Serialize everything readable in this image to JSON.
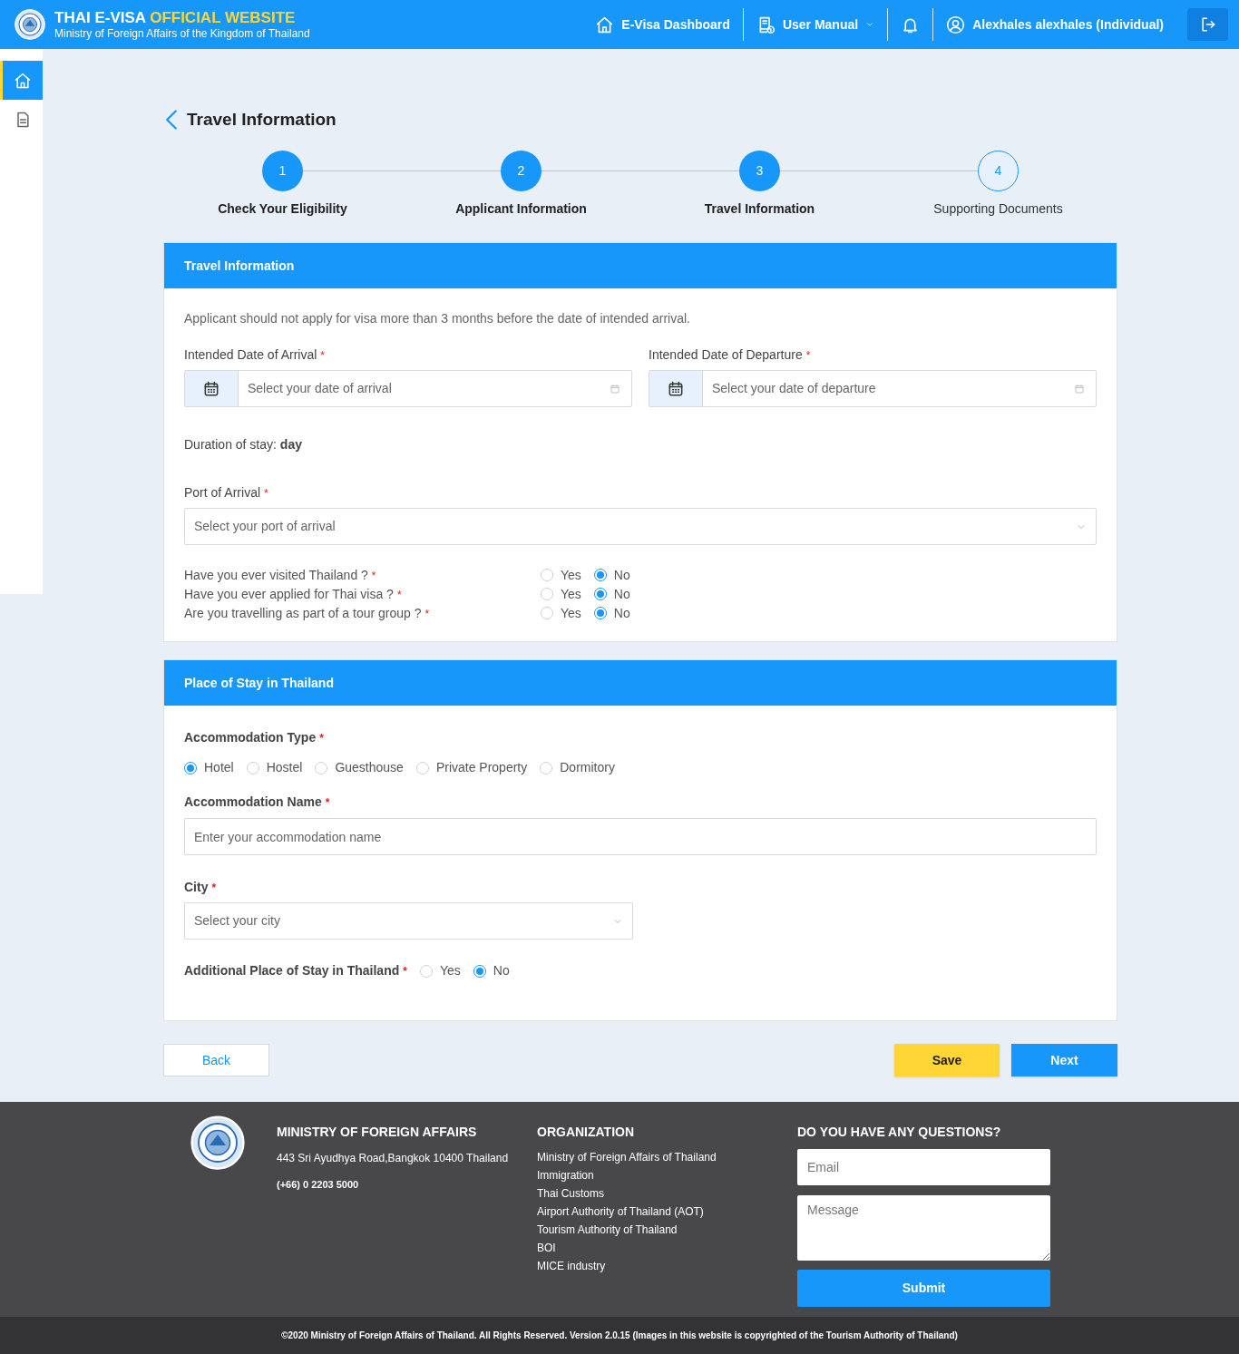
{
  "header": {
    "title": "THAI E-VISA",
    "title_highlight": "OFFICIAL WEBSITE",
    "subtitle": "Ministry of Foreign Affairs of the Kingdom of Thailand",
    "nav": [
      {
        "kind": "home",
        "label": "E-Visa Dashboard"
      },
      {
        "kind": "manual",
        "label": "User Manual"
      },
      {
        "kind": "bell"
      },
      {
        "kind": "user",
        "label": "Alexhales alexhales (Individual)"
      }
    ]
  },
  "sidebar": {
    "items": [
      {
        "kind": "home",
        "selected": true
      },
      {
        "kind": "document",
        "selected": false
      }
    ]
  },
  "page_title": "Travel Information",
  "steps": [
    {
      "number": "1",
      "label": "Check Your Eligibility",
      "completed": true
    },
    {
      "number": "2",
      "label": "Applicant Information",
      "completed": true
    },
    {
      "number": "3",
      "label": "Travel Information",
      "completed": true
    },
    {
      "number": "4",
      "label": "Supporting Documents",
      "completed": false
    }
  ],
  "travel": {
    "title": "Travel Information",
    "note": "Applicant should not apply for visa more than 3 months before the date of intended arrival.",
    "arrival": {
      "label": "Intended Date of Arrival",
      "mark": "*",
      "placeholder": "Select your date of arrival"
    },
    "departure": {
      "label": "Intended Date of Departure",
      "mark": "*",
      "placeholder": "Select your date of departure"
    },
    "duration": "Duration of stay: **day**",
    "port": {
      "label": "Port of Arrival",
      "mark": "*",
      "placeholder": "Select your port of arrival"
    },
    "questions": [
      {
        "label": "Have you ever visited Thailand ?",
        "mark": "*",
        "options": [
          {
            "label": "Yes",
            "selected": false
          },
          {
            "label": "No",
            "selected": true
          }
        ]
      },
      {
        "label": "Have you ever applied for Thai visa ?",
        "mark": "*",
        "options": [
          {
            "label": "Yes",
            "selected": false
          },
          {
            "label": "No",
            "selected": true
          }
        ]
      },
      {
        "label": "Are you travelling as part of a tour group ?",
        "mark": "*",
        "options": [
          {
            "label": "Yes",
            "selected": false
          },
          {
            "label": "No",
            "selected": true
          }
        ]
      }
    ]
  },
  "stay": {
    "title": "Place of Stay in Thailand",
    "type": {
      "label": "Accommodation Type",
      "mark": "*",
      "options": [
        {
          "label": "Hotel",
          "selected": true
        },
        {
          "label": "Hostel",
          "selected": false
        },
        {
          "label": "Guesthouse",
          "selected": false
        },
        {
          "label": "Private Property",
          "selected": false
        },
        {
          "label": "Dormitory",
          "selected": false
        }
      ]
    },
    "name": {
      "label": "Accommodation Name",
      "mark": "*",
      "placeholder": "Enter your accommodation name"
    },
    "city": {
      "label": "City",
      "mark": "*",
      "placeholder": "Select your city"
    },
    "additional": {
      "label": "Additional Place of Stay in Thailand",
      "mark": "*",
      "options": [
        {
          "label": "Yes",
          "selected": false
        },
        {
          "label": "No",
          "selected": true
        }
      ]
    }
  },
  "buttons": {
    "back": "Back",
    "save": "Save",
    "next": "Next"
  },
  "footer": {
    "ministry": {
      "heading": "MINISTRY OF FOREIGN AFFAIRS",
      "address": "443 Sri Ayudhya Road,Bangkok 10400 Thailand",
      "phone": "(+66) 0 2203 5000"
    },
    "organization": {
      "heading": "ORGANIZATION",
      "links": [
        "Ministry of Foreign Affairs of Thailand",
        "Immigration",
        "Thai Customs",
        "Airport Authority of Thailand (AOT)",
        "Tourism Authority of Thailand",
        "BOI",
        "MICE industry"
      ]
    },
    "contact": {
      "heading": "DO YOU HAVE ANY QUESTIONS?",
      "email_placeholder": "Email",
      "message_placeholder": "Message",
      "submit": "Submit"
    },
    "copyright": "©2020 Ministry of Foreign Affairs of Thailand. All Rights Reserved. Version 2.0.15 (Images in this website is copyrighted of the Tourism Authority of Thailand)"
  }
}
